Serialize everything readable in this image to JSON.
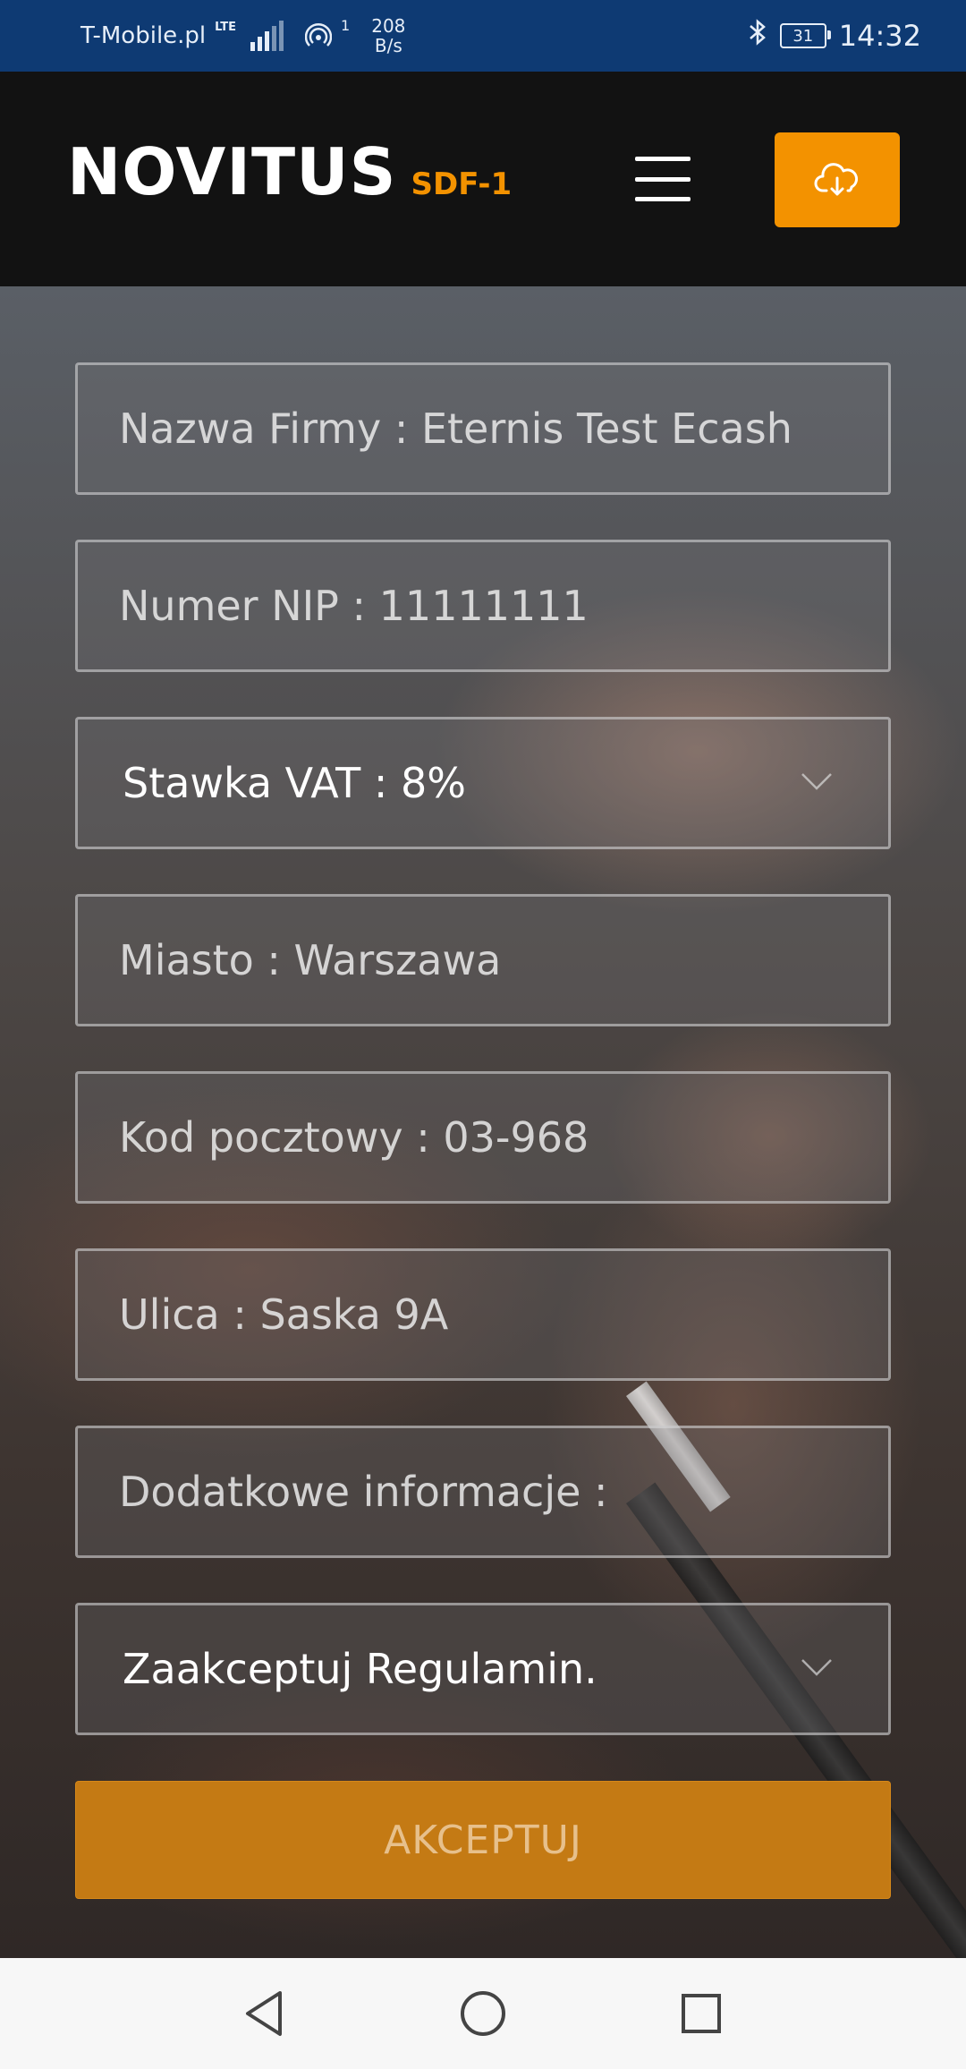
{
  "status_bar": {
    "carrier": "T-Mobile.pl",
    "network": "LTE",
    "hotspot_count": "1",
    "speed_value": "208",
    "speed_unit": "B/s",
    "battery": "31",
    "time": "14:32",
    "bluetooth_icon": "bluetooth-icon"
  },
  "header": {
    "brand": "NOVITUS",
    "brand_sub": "SDF-1",
    "menu_icon": "hamburger-menu-icon",
    "download_icon": "cloud-download-icon",
    "accent_color": "#f39200"
  },
  "form": {
    "company": "Nazwa Firmy : Eternis Test Ecash",
    "nip": "Numer NIP : 11111111",
    "vat": "Stawka VAT : 8%",
    "city": "Miasto : Warszawa",
    "postal": "Kod pocztowy : 03-968",
    "street": "Ulica : Saska 9A",
    "extra": "Dodatkowe informacje :",
    "terms": "Zaakceptuj Regulamin.",
    "accept_label": "AKCEPTUJ"
  },
  "nav": {
    "back_icon": "back-triangle-icon",
    "home_icon": "home-circle-icon",
    "recents_icon": "recents-square-icon"
  }
}
